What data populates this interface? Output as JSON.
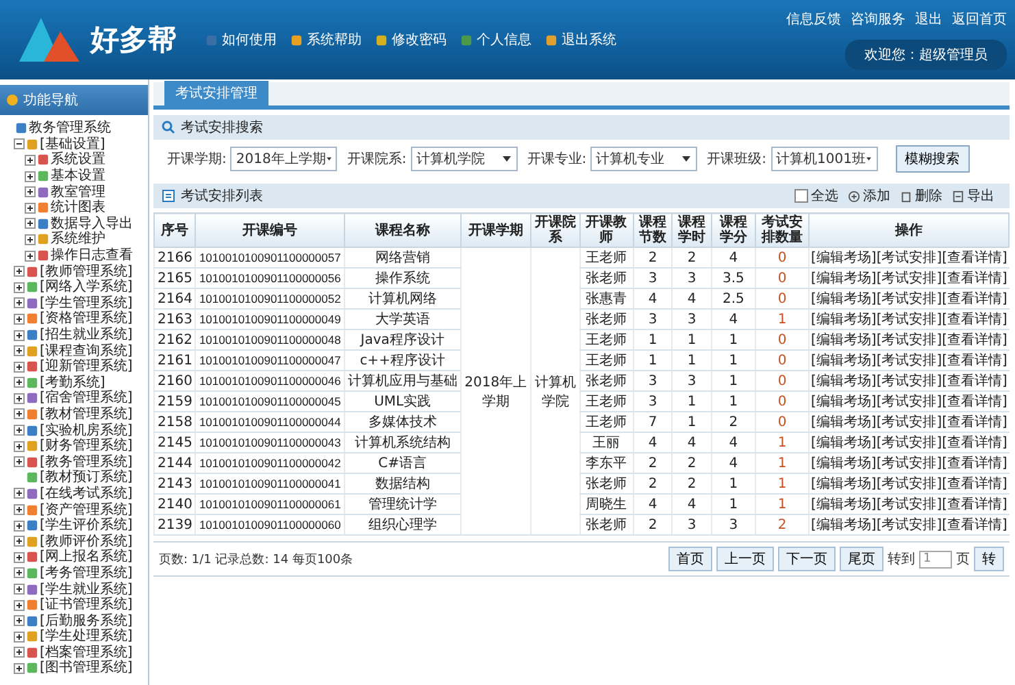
{
  "header": {
    "logo_text": "好多帮",
    "nav": [
      {
        "label": "如何使用"
      },
      {
        "label": "系统帮助"
      },
      {
        "label": "修改密码"
      },
      {
        "label": "个人信息"
      },
      {
        "label": "退出系统"
      }
    ],
    "top_links": [
      {
        "label": "信息反馈"
      },
      {
        "label": "咨询服务"
      },
      {
        "label": "退出"
      },
      {
        "label": "返回首页"
      }
    ],
    "welcome": "欢迎您：超级管理员"
  },
  "sidebar": {
    "title": "功能导航",
    "tree": [
      {
        "label": "教务管理系统"
      },
      {
        "label": "[基础设置]",
        "expanded": true,
        "children": [
          {
            "label": "系统设置",
            "expanded": false
          },
          {
            "label": "基本设置",
            "expanded": false
          },
          {
            "label": "教室管理",
            "expanded": false
          },
          {
            "label": "统计图表",
            "expanded": false
          },
          {
            "label": "数据导入导出",
            "expanded": false
          },
          {
            "label": "系统维护",
            "expanded": false
          },
          {
            "label": "操作日志查看",
            "expanded": false
          }
        ]
      },
      {
        "label": "[教师管理系统]",
        "expanded": false
      },
      {
        "label": "[网络入学系统]",
        "expanded": false
      },
      {
        "label": "[学生管理系统]",
        "expanded": false
      },
      {
        "label": "[资格管理系统]",
        "expanded": false
      },
      {
        "label": "[招生就业系统]",
        "expanded": false
      },
      {
        "label": "[课程查询系统]",
        "expanded": false
      },
      {
        "label": "[迎新管理系统]",
        "expanded": false
      },
      {
        "label": "[考勤系统]",
        "expanded": false
      },
      {
        "label": "[宿舍管理系统]",
        "expanded": false
      },
      {
        "label": "[教材管理系统]",
        "expanded": false
      },
      {
        "label": "[实验机房系统]",
        "expanded": false
      },
      {
        "label": "[财务管理系统]",
        "expanded": false
      },
      {
        "label": "[教务管理系统]",
        "expanded": false
      },
      {
        "label": "[教材预订系统]"
      },
      {
        "label": "[在线考试系统]",
        "expanded": false
      },
      {
        "label": "[资产管理系统]",
        "expanded": false
      },
      {
        "label": "[学生评价系统]",
        "expanded": false
      },
      {
        "label": "[教师评价系统]",
        "expanded": false
      },
      {
        "label": "[网上报名系统]",
        "expanded": false
      },
      {
        "label": "[考务管理系统]",
        "expanded": false
      },
      {
        "label": "[学生就业系统]",
        "expanded": false
      },
      {
        "label": "[证书管理系统]",
        "expanded": false
      },
      {
        "label": "[后勤服务系统]",
        "expanded": false
      },
      {
        "label": "[学生处理系统]",
        "expanded": false
      },
      {
        "label": "[档案管理系统]",
        "expanded": false
      },
      {
        "label": "[图书管理系统]",
        "expanded": false
      }
    ]
  },
  "tabs": [
    {
      "label": "考试安排管理",
      "selected": true
    }
  ],
  "search": {
    "title": "考试安排搜索",
    "filters": [
      {
        "label": "开课学期:",
        "value": "2018年上学期"
      },
      {
        "label": "开课院系:",
        "value": "计算机学院"
      },
      {
        "label": "开课专业:",
        "value": "计算机专业"
      },
      {
        "label": "开课班级:",
        "value": "计算机1001班"
      }
    ],
    "button": "模糊搜索"
  },
  "list": {
    "title": "考试安排列表",
    "actions": [
      {
        "label": "全选",
        "kind": "checkbox",
        "checked": false
      },
      {
        "label": "添加",
        "kind": "add"
      },
      {
        "label": "删除",
        "kind": "delete"
      },
      {
        "label": "导出",
        "kind": "export"
      }
    ]
  },
  "table": {
    "columns": [
      "序号",
      "开课编号",
      "课程名称",
      "开课学期",
      "开课院系",
      "开课教师",
      "课程节数",
      "课程学时",
      "课程学分",
      "考试安排数量",
      "操作"
    ],
    "semester": "2018年上学期",
    "department": "计算机学院",
    "rows": [
      {
        "no": "2166",
        "code": "1010010100901100000057",
        "course": "网络营销",
        "teacher": "王老师",
        "sessions": "2",
        "hours": "2",
        "credits": "4",
        "exams": "0",
        "actions": [
          "[编辑考场]",
          "[考试安排]",
          "[查看详情]"
        ]
      },
      {
        "no": "2165",
        "code": "1010010100901100000056",
        "course": "操作系统",
        "teacher": "张老师",
        "sessions": "3",
        "hours": "3",
        "credits": "3.5",
        "exams": "0",
        "actions": [
          "[编辑考场]",
          "[考试安排]",
          "[查看详情]"
        ]
      },
      {
        "no": "2164",
        "code": "1010010100901100000052",
        "course": "计算机网络",
        "teacher": "张惠青",
        "sessions": "4",
        "hours": "4",
        "credits": "2.5",
        "exams": "0",
        "actions": [
          "[编辑考场]",
          "[考试安排]",
          "[查看详情]"
        ]
      },
      {
        "no": "2163",
        "code": "1010010100901100000049",
        "course": "大学英语",
        "teacher": "张老师",
        "sessions": "3",
        "hours": "3",
        "credits": "4",
        "exams": "1",
        "actions": [
          "[编辑考场]",
          "[考试安排]",
          "[查看详情]"
        ]
      },
      {
        "no": "2162",
        "code": "1010010100901100000048",
        "course": "Java程序设计",
        "teacher": "王老师",
        "sessions": "1",
        "hours": "1",
        "credits": "1",
        "exams": "0",
        "actions": [
          "[编辑考场]",
          "[考试安排]",
          "[查看详情]"
        ]
      },
      {
        "no": "2161",
        "code": "1010010100901100000047",
        "course": "c++程序设计",
        "teacher": "王老师",
        "sessions": "1",
        "hours": "1",
        "credits": "1",
        "exams": "0",
        "actions": [
          "[编辑考场]",
          "[考试安排]",
          "[查看详情]"
        ]
      },
      {
        "no": "2160",
        "code": "1010010100901100000046",
        "course": "计算机应用与基础",
        "teacher": "张老师",
        "sessions": "3",
        "hours": "3",
        "credits": "1",
        "exams": "0",
        "actions": [
          "[编辑考场]",
          "[考试安排]",
          "[查看详情]"
        ]
      },
      {
        "no": "2159",
        "code": "1010010100901100000045",
        "course": "UML实践",
        "teacher": "王老师",
        "sessions": "3",
        "hours": "1",
        "credits": "1",
        "exams": "0",
        "actions": [
          "[编辑考场]",
          "[考试安排]",
          "[查看详情]"
        ]
      },
      {
        "no": "2158",
        "code": "1010010100901100000044",
        "course": "多媒体技术",
        "teacher": "王老师",
        "sessions": "7",
        "hours": "1",
        "credits": "2",
        "exams": "0",
        "actions": [
          "[编辑考场]",
          "[考试安排]",
          "[查看详情]"
        ]
      },
      {
        "no": "2145",
        "code": "1010010100901100000043",
        "course": "计算机系统结构",
        "teacher": "王丽",
        "sessions": "4",
        "hours": "4",
        "credits": "4",
        "exams": "1",
        "actions": [
          "[编辑考场]",
          "[考试安排]",
          "[查看详情]"
        ]
      },
      {
        "no": "2144",
        "code": "1010010100901100000042",
        "course": "C#语言",
        "teacher": "李东平",
        "sessions": "2",
        "hours": "2",
        "credits": "4",
        "exams": "1",
        "actions": [
          "[编辑考场]",
          "[考试安排]",
          "[查看详情]"
        ]
      },
      {
        "no": "2143",
        "code": "1010010100901100000041",
        "course": "数据结构",
        "teacher": "张老师",
        "sessions": "2",
        "hours": "2",
        "credits": "1",
        "exams": "1",
        "actions": [
          "[编辑考场]",
          "[考试安排]",
          "[查看详情]"
        ]
      },
      {
        "no": "2140",
        "code": "1010010100901100000061",
        "course": "管理统计学",
        "teacher": "周晓生",
        "sessions": "4",
        "hours": "4",
        "credits": "1",
        "exams": "1",
        "actions": [
          "[编辑考场]",
          "[考试安排]",
          "[查看详情]"
        ]
      },
      {
        "no": "2139",
        "code": "1010010100901100000060",
        "course": "组织心理学",
        "teacher": "张老师",
        "sessions": "2",
        "hours": "3",
        "credits": "3",
        "exams": "2",
        "actions": [
          "[编辑考场]",
          "[考试安排]",
          "[查看详情]"
        ]
      }
    ]
  },
  "pager": {
    "info": "页数: 1/1 记录总数: 14 每页100条",
    "buttons": [
      "首页",
      "上一页",
      "下一页",
      "尾页"
    ],
    "goto_label": "转到",
    "goto_value": "1",
    "unit": "页",
    "go": "转"
  }
}
